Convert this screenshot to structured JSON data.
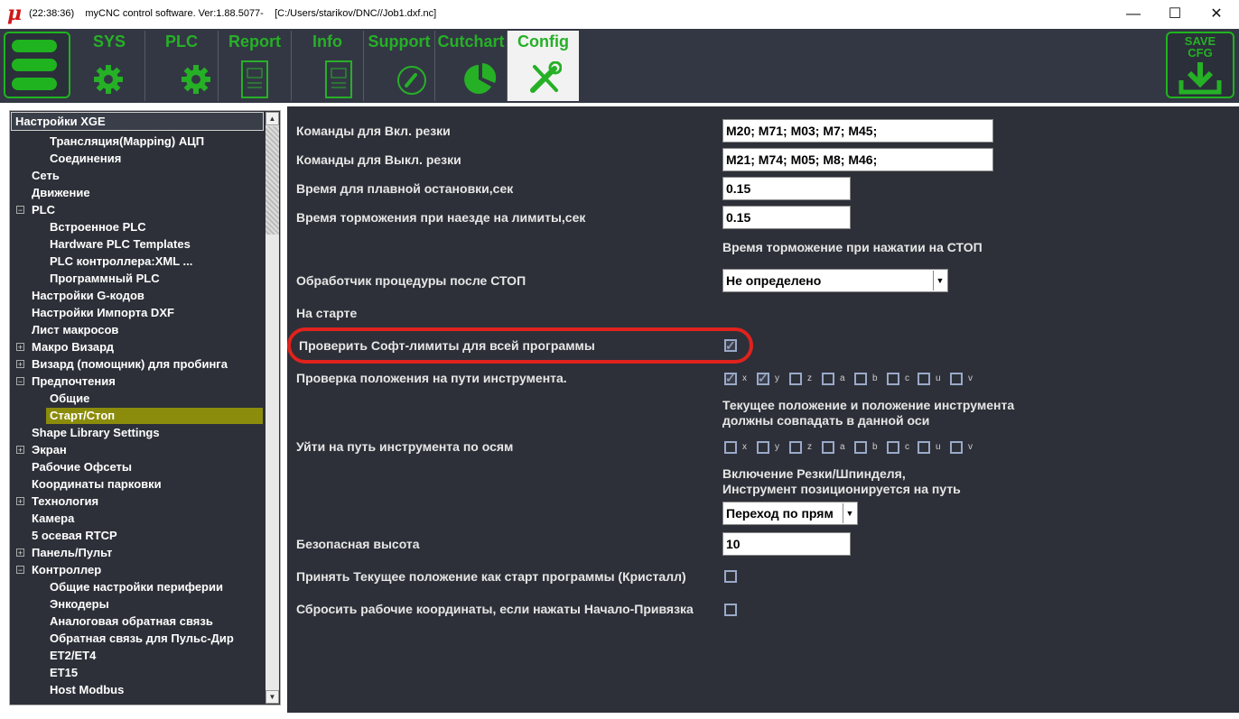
{
  "window": {
    "logo": "μ",
    "title": "(22:38:36)    myCNC control software. Ver:1.88.5077-    [C:/Users/starikov/DNC//Job1.dxf.nc]",
    "minimize": "—",
    "maximize": "☐",
    "close": "✕"
  },
  "toolbar": {
    "tabs": [
      {
        "label": "SYS",
        "icon": "gear-icon"
      },
      {
        "label": "PLC",
        "icon": "gear-icon"
      },
      {
        "label": "Report",
        "icon": "document-icon"
      },
      {
        "label": "Info",
        "icon": "document-icon"
      },
      {
        "label": "Support",
        "icon": "phone-icon"
      },
      {
        "label": "Cutchart",
        "icon": "pie-chart-icon"
      },
      {
        "label": "Config",
        "icon": "tools-icon"
      }
    ],
    "active_tab": "Config",
    "save_label_1": "SAVE",
    "save_label_2": "CFG",
    "accent": "#1fb31f"
  },
  "tree": {
    "header": "Настройки XGE",
    "items": [
      {
        "label": "Трансляция(Mapping) АЦП"
      },
      {
        "label": "Соединения"
      },
      {
        "label": "Сеть"
      },
      {
        "label": "Движение"
      },
      {
        "label": "PLC"
      },
      {
        "label": "Встроенное PLC"
      },
      {
        "label": "Hardware PLC Templates"
      },
      {
        "label": "PLC контроллера:XML ..."
      },
      {
        "label": "Программный PLC"
      },
      {
        "label": "Настройки G-кодов"
      },
      {
        "label": "Настройки Импорта DXF"
      },
      {
        "label": "Лист макросов"
      },
      {
        "label": "Макро Визард"
      },
      {
        "label": "Визард (помощник) для пробинга"
      },
      {
        "label": "Предпочтения"
      },
      {
        "label": "Общие"
      },
      {
        "label": "Старт/Стоп"
      },
      {
        "label": "Shape Library Settings"
      },
      {
        "label": "Экран"
      },
      {
        "label": "Рабочие Офсеты"
      },
      {
        "label": "Координаты парковки"
      },
      {
        "label": "Технология"
      },
      {
        "label": "Камера"
      },
      {
        "label": "5 осевая RTCP"
      },
      {
        "label": "Панель/Пульт"
      },
      {
        "label": "Контроллер"
      },
      {
        "label": "Общие настройки периферии"
      },
      {
        "label": "Энкодеры"
      },
      {
        "label": "Аналоговая обратная связь"
      },
      {
        "label": "Обратная связь для Пульс-Дир"
      },
      {
        "label": "ET2/ET4"
      },
      {
        "label": "ET15"
      },
      {
        "label": "Host Modbus"
      }
    ],
    "selected": "Старт/Стоп",
    "expander": "+",
    "collapse": "−",
    "scroll_up": "▲",
    "scroll_down": "▼"
  },
  "settings": {
    "cut_on_label": "Команды для Вкл. резки",
    "cut_on_value": "M20; M71; M03; M7; M45;",
    "cut_off_label": "Команды для Выкл. резки",
    "cut_off_value": "M21; M74; M05; M8; M46;",
    "smooth_stop_label": "Время для плавной остановки,сек",
    "smooth_stop_value": "0.15",
    "limit_brake_label": "Время торможения при наезде на лимиты,сек",
    "limit_brake_value": "0.15",
    "stop_brake_note": "Время торможение при нажатии на СТОП",
    "after_stop_label": "Обработчик процедуры после СТОП",
    "after_stop_value": "Не определено",
    "on_start_label": "На старте",
    "soft_limits_label": "Проверить Софт-лимиты для всей программы",
    "soft_limits_checked": true,
    "path_check_label": "Проверка положения на пути инструмента.",
    "axes": [
      "x",
      "y",
      "z",
      "a",
      "b",
      "c",
      "u",
      "v"
    ],
    "path_check_axes_checked": [
      true,
      true,
      false,
      false,
      false,
      false,
      false,
      false
    ],
    "path_check_note_1": "Текущее положение и положение инструмента",
    "path_check_note_2": "должны совпадать в данной оси",
    "goto_path_label": "Уйти на путь инструмента по осям",
    "goto_path_axes_checked": [
      false,
      false,
      false,
      false,
      false,
      false,
      false,
      false
    ],
    "spindle_note_1": "Включение Резки/Шпинделя,",
    "spindle_note_2": "Инструмент позиционируется на путь",
    "transition_value": "Переход по прям",
    "safe_height_label": "Безопасная высота",
    "safe_height_value": "10",
    "accept_pos_label": "Принять Текущее положение как старт программы (Кристалл)",
    "reset_coords_label": "Сбросить рабочие координаты, если нажаты Начало-Привязка",
    "dropdown_arrow": "▼",
    "check_mark": "✓"
  }
}
